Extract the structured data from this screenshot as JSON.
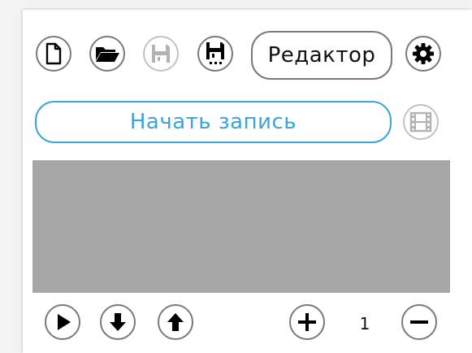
{
  "toolbar": {
    "new_icon": "new-file-icon",
    "open_icon": "open-folder-icon",
    "save_icon": "save-icon",
    "save_as_icon": "save-as-icon",
    "editor_label": "Редактор",
    "settings_icon": "gear-icon"
  },
  "record": {
    "label": "Начать запись",
    "film_icon": "film-icon"
  },
  "preview": {
    "color": "#a7a7a7"
  },
  "controls": {
    "play_icon": "play-icon",
    "down_icon": "arrow-down-icon",
    "up_icon": "arrow-up-icon",
    "plus_icon": "plus-icon",
    "count": "1",
    "minus_icon": "minus-icon"
  },
  "colors": {
    "accent": "#3ba4d8",
    "border": "#7a7a7a",
    "disabled": "#c2c2c2"
  }
}
